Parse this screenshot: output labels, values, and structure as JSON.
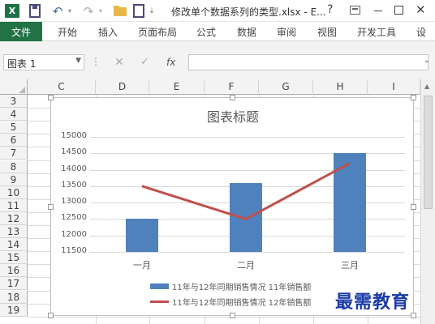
{
  "app": {
    "window_title": "修改单个数据系列的类型.xlsx - E...",
    "excel_logo": "X",
    "help": "?"
  },
  "ribbon": {
    "file_tab": "文件",
    "tabs": [
      "开始",
      "插入",
      "页面布局",
      "公式",
      "数据",
      "审阅",
      "视图",
      "开发工具",
      "设"
    ]
  },
  "formula_bar": {
    "name_box": "图表 1",
    "fx": "fx",
    "cancel": "✕",
    "enter": "✓",
    "formula": ""
  },
  "grid": {
    "columns": [
      "C",
      "D",
      "E",
      "F",
      "G",
      "H",
      "I"
    ],
    "rows": [
      "3",
      "4",
      "5",
      "6",
      "7",
      "8",
      "9",
      "10",
      "11",
      "12",
      "13",
      "14",
      "15",
      "16",
      "17",
      "18",
      "19"
    ]
  },
  "chart_data": {
    "type": "bar",
    "title": "图表标题",
    "categories": [
      "一月",
      "二月",
      "三月"
    ],
    "yticks": [
      "15000",
      "14500",
      "14000",
      "13500",
      "13000",
      "12500",
      "12000",
      "11500"
    ],
    "ylim": [
      11500,
      15000
    ],
    "grid": true,
    "legend_position": "bottom",
    "series": [
      {
        "name": "11年与12年同期销售情况 11年销售额",
        "type": "bar",
        "color": "#4f81bd",
        "values": [
          12500,
          13600,
          14500
        ]
      },
      {
        "name": "11年与12年同期销售情况 12年销售额",
        "type": "line",
        "color": "#c0504d",
        "values": [
          13500,
          12500,
          14200
        ]
      }
    ]
  },
  "watermark": "最需教育"
}
